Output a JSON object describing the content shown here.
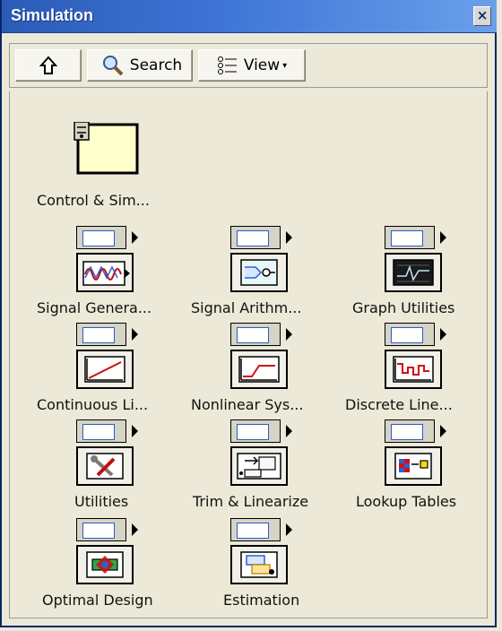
{
  "window": {
    "title": "Simulation",
    "close_glyph": "×"
  },
  "toolbar": {
    "up_icon": "up-arrow-icon",
    "search_label": "Search",
    "view_label": "View",
    "view_caret": "▾"
  },
  "palette": {
    "items": [
      {
        "label": "Control & Sim...",
        "icon": "control-sim-loop-icon"
      },
      {
        "label": "Signal Genera...",
        "icon": "signal-generation-icon"
      },
      {
        "label": "Signal Arithm...",
        "icon": "signal-arithmetic-icon"
      },
      {
        "label": "Graph Utilities",
        "icon": "graph-utilities-icon"
      },
      {
        "label": "Continuous Li...",
        "icon": "continuous-linear-icon"
      },
      {
        "label": "Nonlinear Sys...",
        "icon": "nonlinear-systems-icon"
      },
      {
        "label": "Discrete Line...",
        "icon": "discrete-linear-icon"
      },
      {
        "label": "Utilities",
        "icon": "utilities-icon"
      },
      {
        "label": "Trim & Linearize",
        "icon": "trim-linearize-icon"
      },
      {
        "label": "Lookup Tables",
        "icon": "lookup-tables-icon"
      },
      {
        "label": "Optimal Design",
        "icon": "optimal-design-icon"
      },
      {
        "label": "Estimation",
        "icon": "estimation-icon"
      }
    ]
  }
}
